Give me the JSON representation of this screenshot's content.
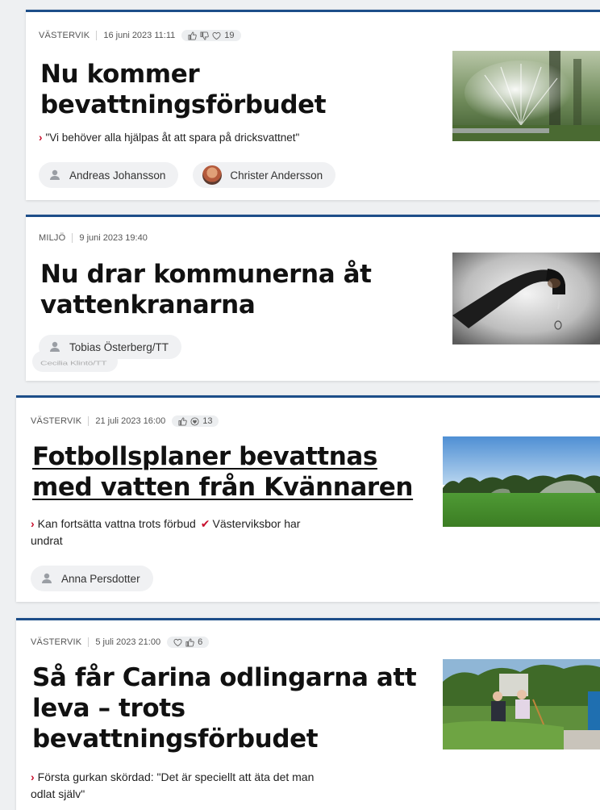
{
  "articles": [
    {
      "section": "VÄSTERVIK",
      "datetime": "16 juni 2023 11:11",
      "reaction_count": "19",
      "title_line1": "Nu kommer",
      "title_line2": "bevattningsförbudet",
      "subheading": "\"Vi behöver alla hjälpas åt att spara på dricksvattnet\"",
      "authors": [
        "Andreas Johansson",
        "Christer Andersson"
      ],
      "image": "sprinkler-photo"
    },
    {
      "section": "MILJÖ",
      "datetime": "9 juni 2023 19:40",
      "title_line1": "Nu drar kommunerna åt",
      "title_line2": "vattenkranarna",
      "authors": [
        "Tobias Österberg/TT"
      ],
      "overlapped_author_fragment": "Cecilia Klintö/TT",
      "image": "dripping-tap-photo"
    },
    {
      "section": "VÄSTERVIK",
      "datetime": "21 juli 2023 16:00",
      "reaction_count": "13",
      "title_line1": "Fotbollsplaner bevattnas",
      "title_line2": "med vatten från Kvännaren",
      "subheading_part1": "Kan fortsätta vattna trots förbud",
      "subheading_part2": "Västerviksbor har",
      "subheading_part3": "undrat",
      "authors": [
        "Anna Persdotter"
      ],
      "image": "football-field-sprinkler-photo"
    },
    {
      "section": "VÄSTERVIK",
      "datetime": "5 juli 2023 21:00",
      "reaction_count": "6",
      "title_line1": "Så får Carina odlingarna att",
      "title_line2": "leva – trots",
      "title_line3": "bevattningsförbudet",
      "subheading_line1": "Första gurkan skördad: \"Det är speciellt att äta det man",
      "subheading_line2": "odlat själv\"",
      "image": "garden-people-photo"
    }
  ],
  "icons": {
    "reactions": [
      "thumb-up-icon",
      "thumb-down-icon",
      "heart-icon"
    ],
    "author": "person-icon",
    "subheading_bullet": "chevron-right-icon",
    "subheading_separator": "checkmark-icon"
  },
  "colors": {
    "accent": "#1d4e89",
    "bullet": "#c8102e",
    "pill_bg": "#f0f1f3"
  }
}
